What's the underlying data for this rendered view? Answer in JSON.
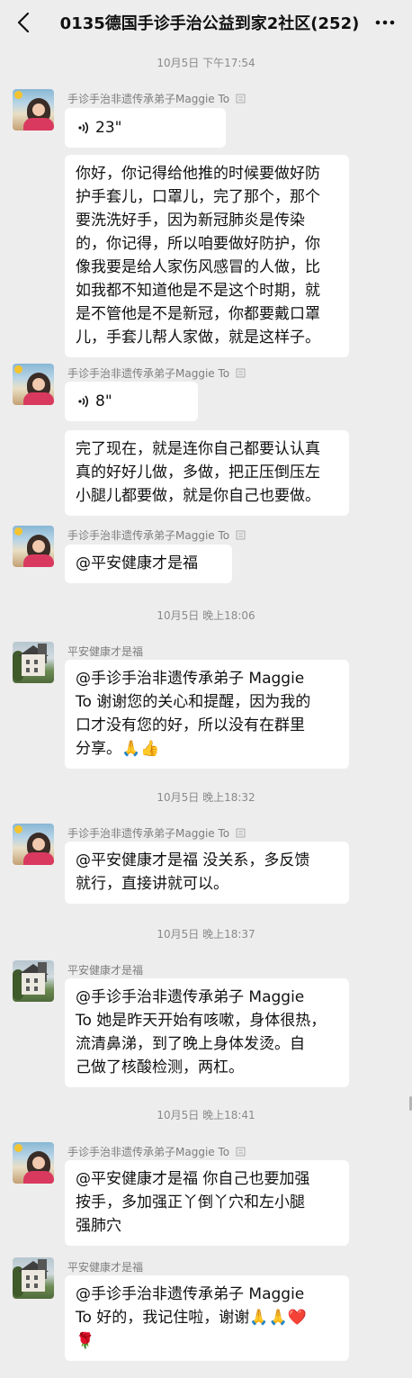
{
  "header": {
    "title": "0135德国手诊手治公益到家2社区(252)"
  },
  "timestamps": [
    "10月5日 下午17:54",
    "10月5日 晚上18:06",
    "10月5日 晚上18:32",
    "10月5日 晚上18:37",
    "10月5日 晚上18:41"
  ],
  "senders": {
    "maggie": "手诊手治非遗传承弟子Maggie To",
    "pingan": "平安健康才是福"
  },
  "messages": {
    "voice1": "23\"",
    "text1": "你好，你记得给他推的时候要做好防\n护手套儿，口罩儿，完了那个，那个\n要洗洗好手，因为新冠肺炎是传染\n的，你记得，所以咱要做好防护，你\n像我要是给人家伤风感冒的人做，比\n如我都不知道他是不是这个时期，就\n是不管他是不是新冠，你都要戴口罩\n儿，手套儿帮人家做，就是这样子。",
    "voice2": "8\"",
    "text2": "完了现在，就是连你自己都要认认真\n真的好好儿做，多做，把正压倒压左\n小腿儿都要做，就是你自己也要做。",
    "text3": "@平安健康才是福",
    "text4": "@手诊手治非遗传承弟子 Maggie\nTo 谢谢您的关心和提醒，因为我的\n口才没有您的好，所以没有在群里\n分享。🙏👍",
    "text5": "@平安健康才是福  没关系，多反馈\n就行，直接讲就可以。",
    "text6": "@手诊手治非遗传承弟子 Maggie\nTo 她是昨天开始有咳嗽，身体很热，\n流清鼻涕，到了晚上身体发烫。自\n己做了核酸检测，两杠。",
    "text7": "@平安健康才是福  你自己也要加强\n按手，多加强正丫倒丫穴和左小腿\n强肺穴",
    "text8": "@手诊手治非遗传承弟子 Maggie\nTo 好的，我记住啦，谢谢🙏🙏❤️\n🌹"
  },
  "icons": {
    "back": "chevron-left-icon",
    "more": "more-dots-icon",
    "voice": "voice-wave-icon",
    "edit": "edit-note-icon"
  },
  "colors": {
    "background": "#ededed",
    "bubble": "#ffffff",
    "timestamp": "#8a8a8a",
    "sender": "#7d7d7d"
  }
}
